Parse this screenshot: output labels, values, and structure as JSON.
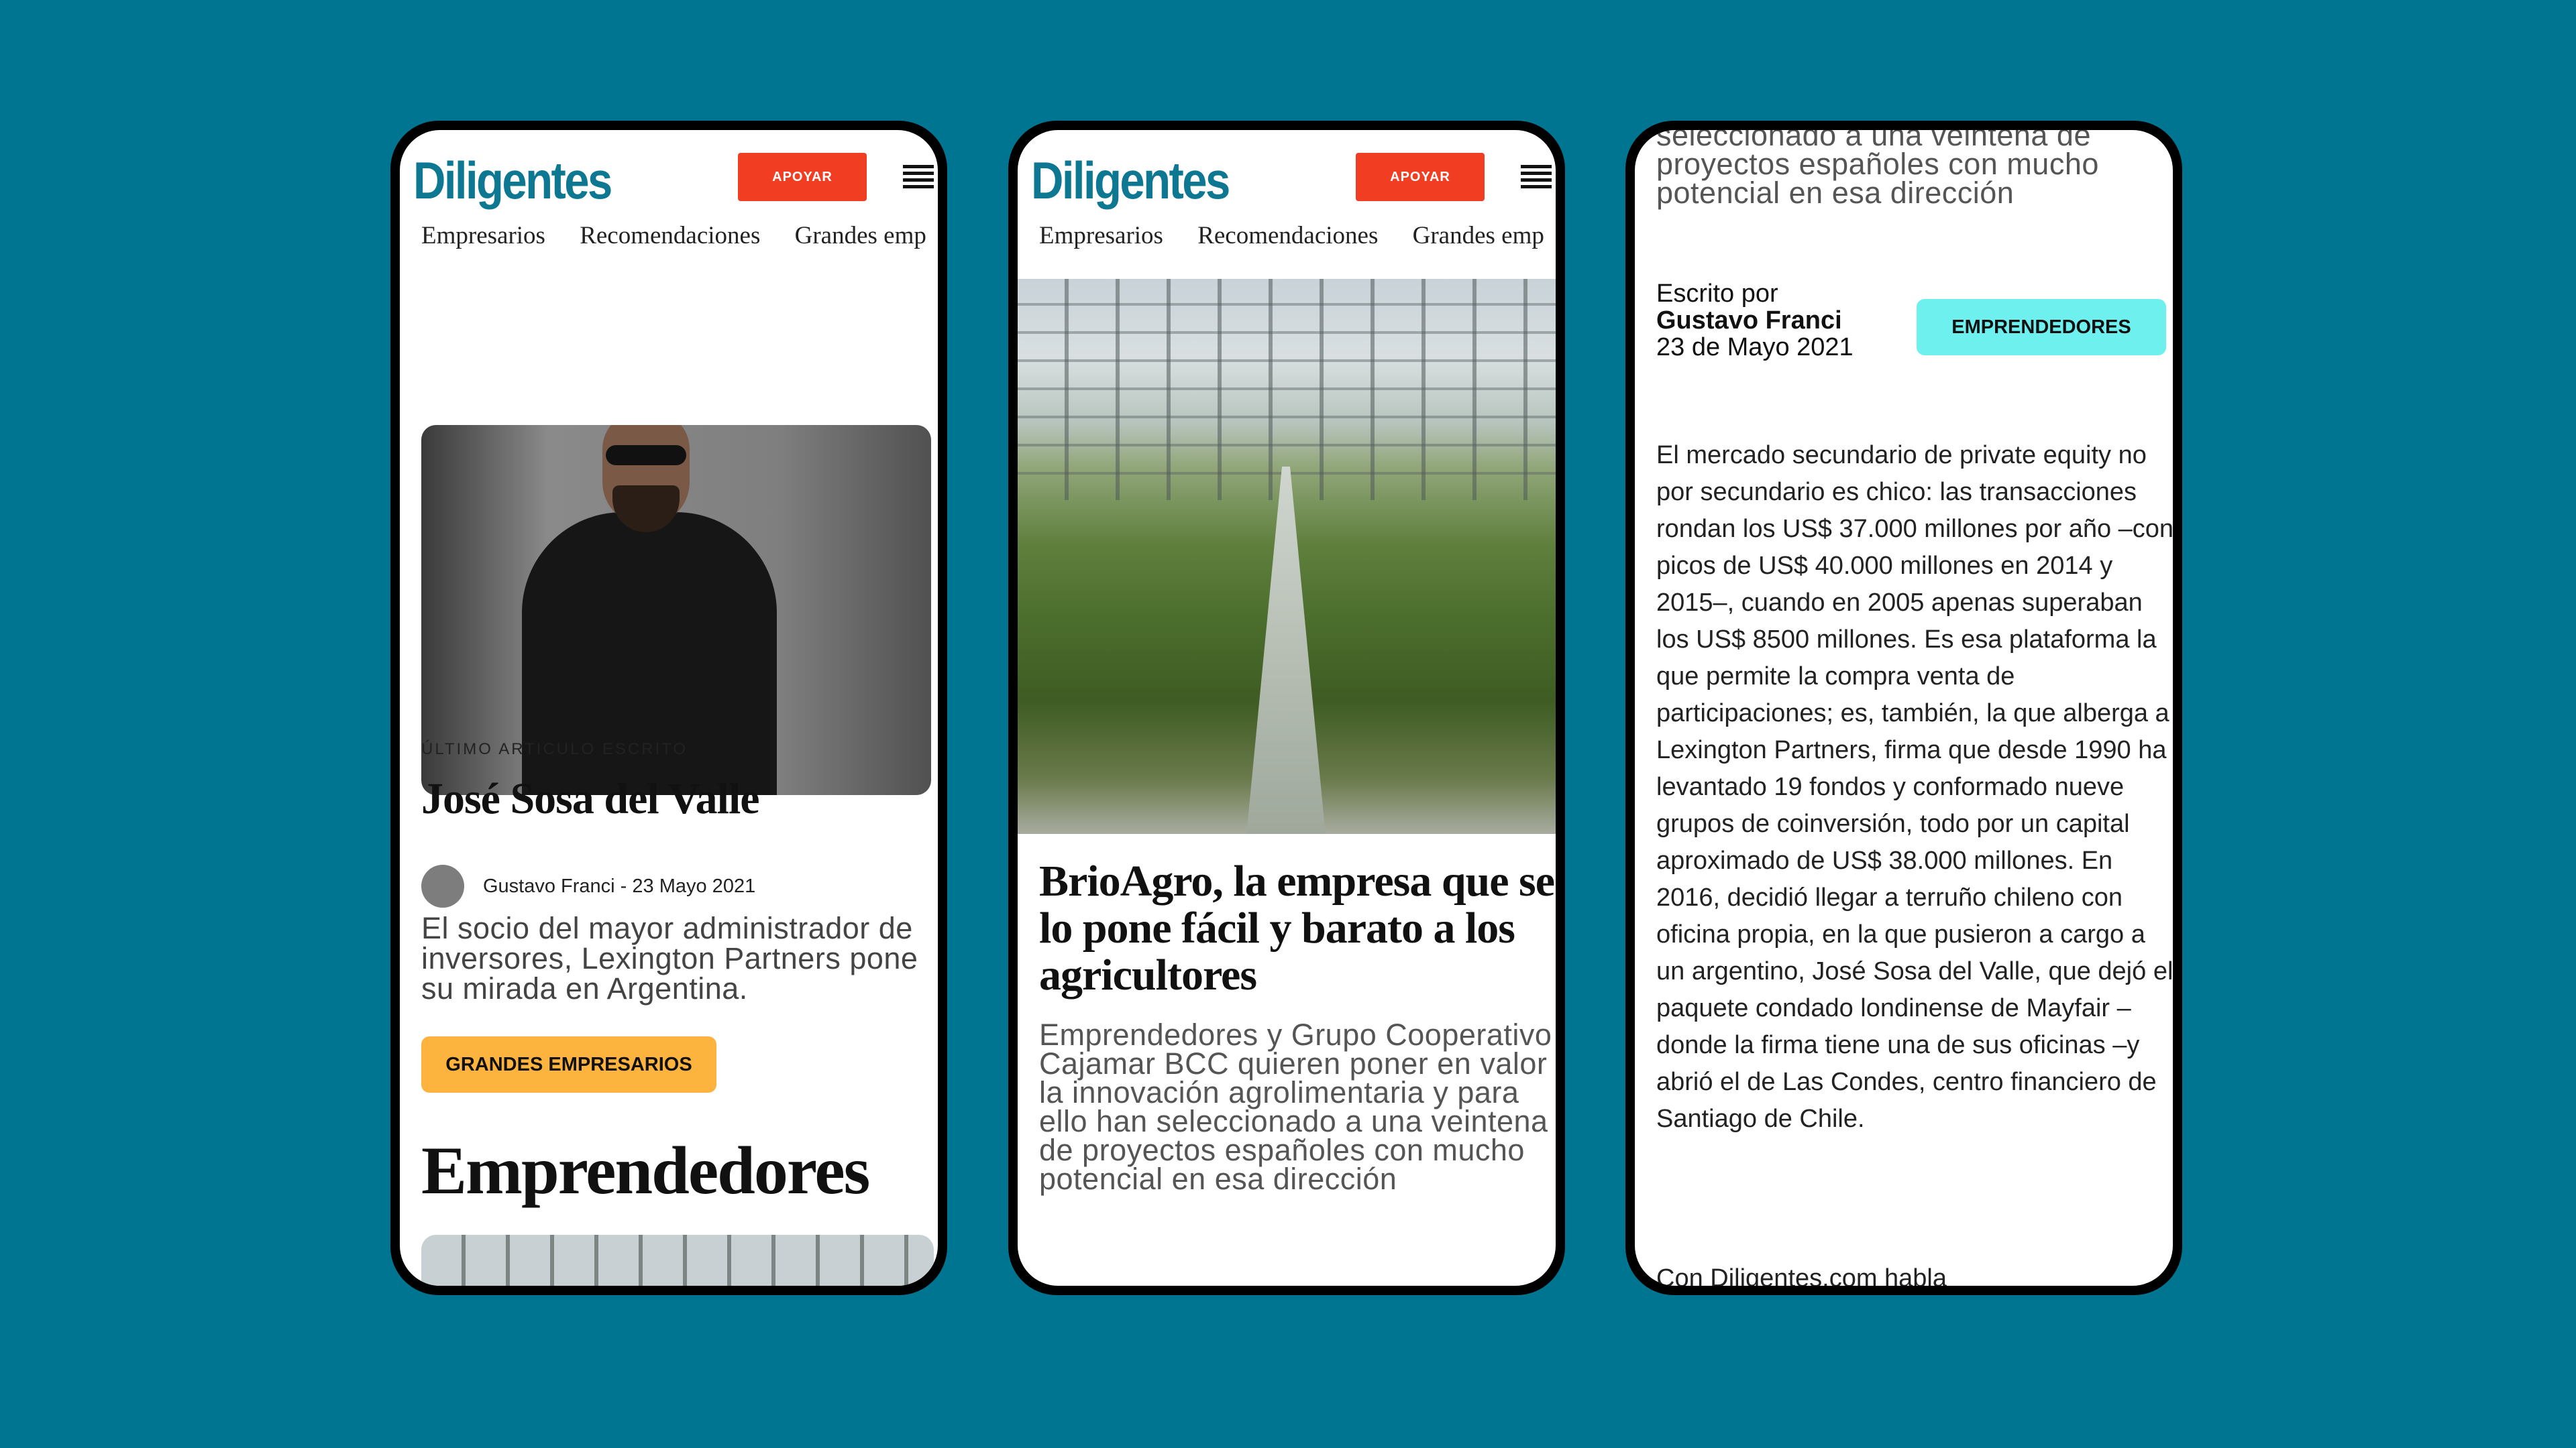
{
  "site": {
    "logo": "Diligentes",
    "support_label": "APOYAR",
    "nav": [
      "Empresarios",
      "Recomendaciones",
      "Grandes emp"
    ]
  },
  "screen1": {
    "kicker": "ÚLTIMO ARTICULO ESCRITO",
    "title": "José Sosa del Valle",
    "byline": "Gustavo Franci - 23 Mayo 2021",
    "lede": "El socio del mayor administrador de inversores, Lexington Partners pone su mirada en Argentina.",
    "tag": "GRANDES EMPRESARIOS",
    "section_title": "Emprendedores"
  },
  "screen2": {
    "title": "BrioAgro, la empresa que se lo pone fácil y barato a los agricultores",
    "excerpt": "Emprendedores y Grupo Cooperativo Cajamar BCC quieren poner en valor la innovación agrolimentaria y para ello han seleccionado a una veintena de proyectos españoles con mucho potencial en esa dirección"
  },
  "screen3": {
    "excerpt_fragment": "seleccionado a una veintena de proyectos españoles con mucho potencial en esa dirección",
    "written_by_label": "Escrito por",
    "author": "Gustavo Franci",
    "date": "23 de Mayo 2021",
    "tag": "EMPRENDEDORES",
    "body": "El mercado secundario de private equity no por secundario es chico: las transacciones rondan los US$ 37.000 millones por año –con picos de US$ 40.000 millones en 2014 y 2015–, cuando en 2005 apenas superaban los US$ 8500 millones. Es esa plataforma la que permite la compra venta de participaciones; es, también, la que alberga a Lexington Partners, firma que desde 1990 ha levantado 19 fondos y conformado nueve grupos de coinversión, todo por un capital aproximado de US$ 38.000 millones. En 2016, decidió llegar a terruño chileno con oficina propia, en la que pusieron a cargo a un argentino, José Sosa del Valle, que dejó el paquete condado londinense de Mayfair –donde la firma tiene una de sus oficinas –y abrió el de Las Condes, centro financiero de Santiago de Chile.",
    "tail": "Con Diligentes.com habla"
  },
  "colors": {
    "background": "#007592",
    "brand": "#0e7893",
    "support_button": "#f13e22",
    "tag_yellow": "#fdb43f",
    "tag_cyan": "#6ef0ee"
  }
}
